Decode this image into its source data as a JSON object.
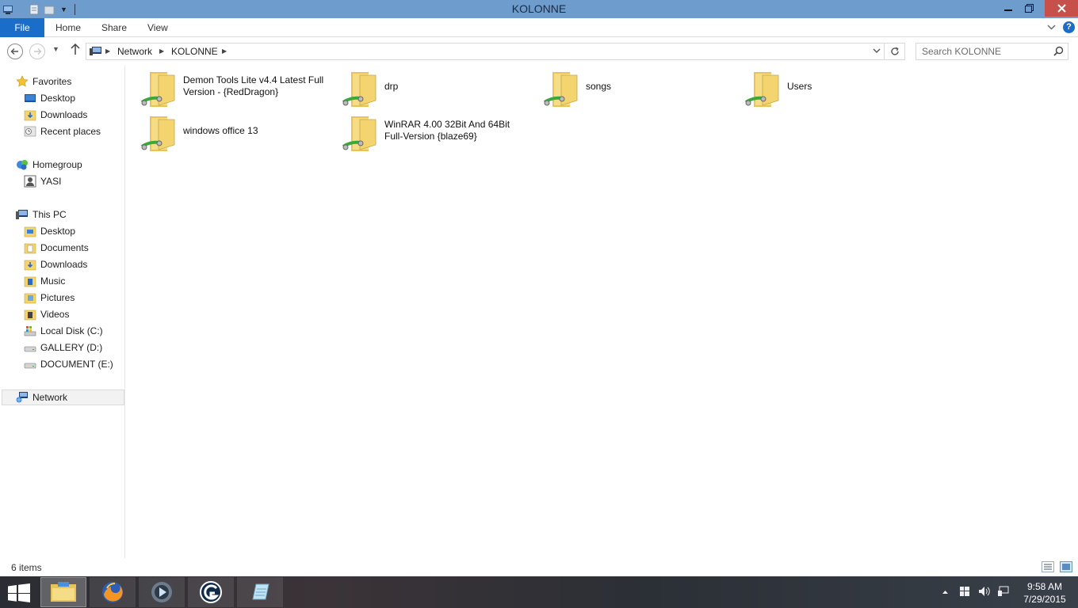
{
  "window": {
    "title": "KOLONNE"
  },
  "ribbon": {
    "tabs": [
      "File",
      "Home",
      "Share",
      "View"
    ]
  },
  "address": {
    "crumbs": [
      "Network",
      "KOLONNE"
    ],
    "search_placeholder": "Search KOLONNE"
  },
  "sidebar": {
    "favorites": {
      "label": "Favorites",
      "items": [
        "Desktop",
        "Downloads",
        "Recent places"
      ]
    },
    "homegroup": {
      "label": "Homegroup",
      "items": [
        "YASI"
      ]
    },
    "thispc": {
      "label": "This PC",
      "items": [
        "Desktop",
        "Documents",
        "Downloads",
        "Music",
        "Pictures",
        "Videos",
        "Local Disk (C:)",
        "GALLERY (D:)",
        "DOCUMENT (E:)"
      ]
    },
    "network": {
      "label": "Network"
    }
  },
  "files": [
    {
      "name": "Demon Tools Lite v4.4 Latest Full Version - {RedDragon}"
    },
    {
      "name": "drp"
    },
    {
      "name": "songs"
    },
    {
      "name": "Users"
    },
    {
      "name": "windows office 13"
    },
    {
      "name": "WinRAR 4.00 32Bit And 64Bit Full-Version {blaze69}"
    }
  ],
  "status": {
    "count": "6 items"
  },
  "taskbar": {
    "apps": [
      "file-explorer",
      "firefox",
      "media-player",
      "app-g",
      "notepad"
    ],
    "time": "9:58 AM",
    "date": "7/29/2015"
  },
  "colors": {
    "titlebar": "#6e9ccc",
    "file_tab": "#1a6dc9",
    "close": "#c7504b",
    "folder": "#f3d46e"
  }
}
